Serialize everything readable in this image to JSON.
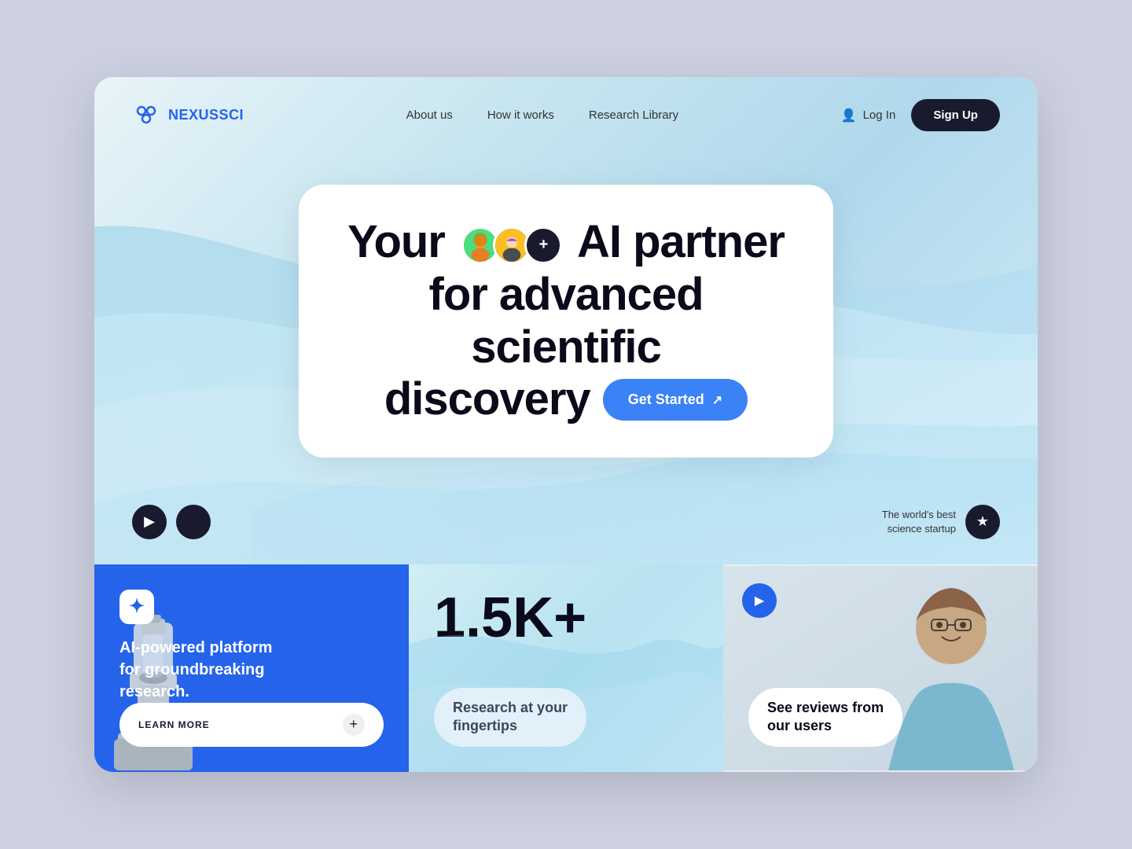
{
  "brand": {
    "name_prefix": "NEXUS",
    "name_suffix": "SCI",
    "logo_symbol": "⬡"
  },
  "nav": {
    "links": [
      {
        "label": "About us",
        "id": "about-us"
      },
      {
        "label": "How it works",
        "id": "how-it-works"
      },
      {
        "label": "Research Library",
        "id": "research-library"
      }
    ],
    "login_label": "Log In",
    "signup_label": "Sign Up"
  },
  "hero": {
    "headline_part1": "Your",
    "headline_part2": "AI partner",
    "headline_part3": "for advanced scientific",
    "headline_part4": "discovery",
    "cta_label": "Get Started",
    "avatars": [
      "👩",
      "👨",
      "+"
    ],
    "app_store_icons": [
      "▶",
      ""
    ],
    "badge_text": "The world's best\nscience startup",
    "badge_icon": "★"
  },
  "cards": {
    "card1": {
      "badge_icon": "+",
      "text": "AI-powered platform for groundbreaking research.",
      "cta": "LEARN MORE"
    },
    "card2": {
      "stat": "1.5K+",
      "label_line1": "Research at your",
      "label_line2": "fingertips"
    },
    "card3": {
      "label_line1": "See reviews from",
      "label_line2": "our users"
    }
  },
  "colors": {
    "brand_blue": "#2563eb",
    "dark": "#1a1a2e",
    "white": "#ffffff"
  }
}
